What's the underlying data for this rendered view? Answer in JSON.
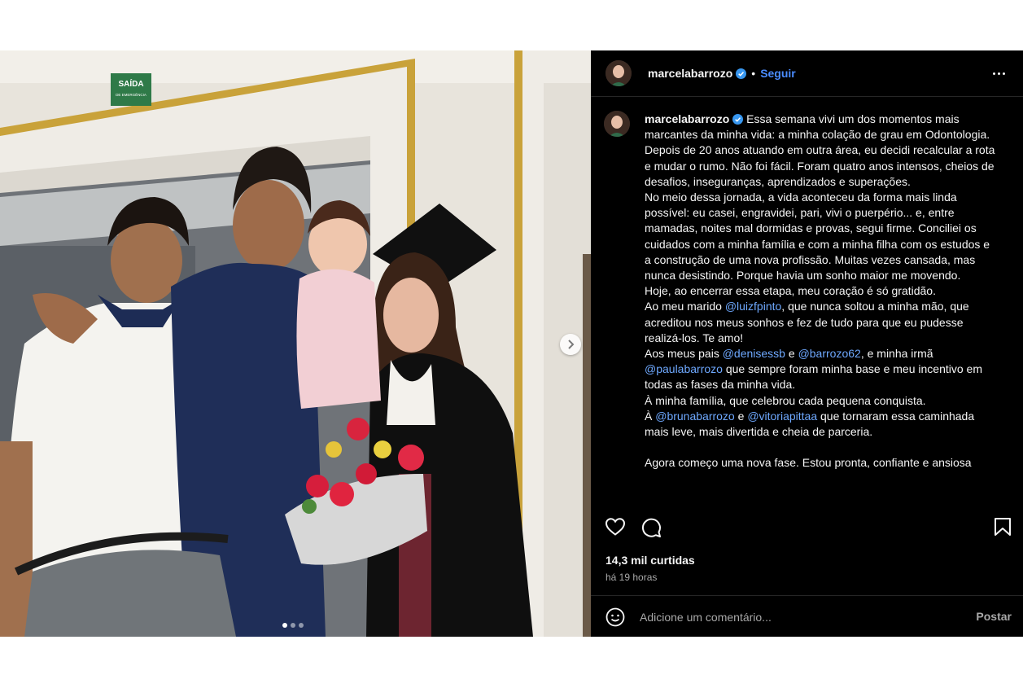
{
  "post": {
    "username": "marcelabarrozo",
    "separator": "•",
    "follow_label": "Seguir",
    "more_icon": "more-horizontal-icon",
    "caption": {
      "username": "marcelabarrozo",
      "p1_text": "Essa semana vivi um dos momentos mais marcantes da minha vida: a minha colação de grau em Odontologia.",
      "p2": "Depois de 20 anos atuando em outra área, eu decidi recalcular a rota e mudar o rumo. Não foi fácil. Foram quatro anos intensos, cheios de desafios, inseguranças, aprendizados e superações.",
      "p3": "No meio dessa jornada, a vida aconteceu da forma mais linda possível: eu casei, engravidei, pari, vivi o puerpério... e, entre mamadas, noites mal dormidas e provas, segui firme. Conciliei os cuidados com a minha família e com a minha filha com os estudos e a construção de uma nova profissão. Muitas vezes cansada, mas nunca desistindo. Porque havia um sonho maior me movendo.",
      "p4": "Hoje, ao encerrar essa etapa, meu coração é só gratidão.",
      "p5_a": "Ao meu marido ",
      "p5_mention": "@luizfpinto",
      "p5_b": ", que nunca soltou a minha mão, que acreditou nos meus sonhos e fez de tudo para que eu pudesse realizá-los. Te amo!",
      "p6_a": "Aos meus pais ",
      "p6_m1": "@denisessb",
      "p6_b": " e ",
      "p6_m2": "@barrozo62",
      "p6_c": ", e minha irmã ",
      "p6_m3": "@paulabarrozo",
      "p6_d": " que sempre foram minha base e meu incentivo em todas as fases da minha vida.",
      "p7": "À minha família, que celebrou cada pequena conquista.",
      "p8_a": "À ",
      "p8_m1": "@brunabarrozo",
      "p8_b": " e ",
      "p8_m2": "@vitoriapittaa",
      "p8_c": " que tornaram essa caminhada mais leve, mais divertida e cheia de parceria.",
      "p9": "Agora começo uma nova fase. Estou pronta, confiante e ansiosa"
    },
    "likes": "14,3 mil curtidas",
    "time_ago": "há 19 horas",
    "comment_placeholder": "Adicione um comentário...",
    "post_button": "Postar"
  },
  "media": {
    "exit_sign_line1": "SAÍDA",
    "exit_sign_line2": "DE EMERGÊNCIA",
    "carousel": {
      "current": 1,
      "total": 3
    }
  },
  "icons": [
    "heart-icon",
    "comment-icon",
    "bookmark-icon",
    "emoji-icon",
    "verified-badge-icon",
    "chevron-right-icon"
  ],
  "colors": {
    "panel_bg": "#000000",
    "link": "#6ea8fe",
    "follow": "#4a8cff",
    "verified": "#3897f0",
    "muted": "#a8a8a8"
  }
}
